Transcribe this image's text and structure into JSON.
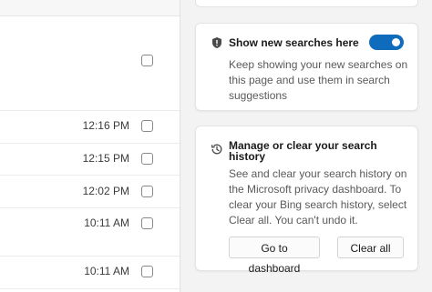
{
  "history_list": {
    "rows": [
      {
        "time": ""
      },
      {
        "time": "12:16 PM"
      },
      {
        "time": "12:15 PM"
      },
      {
        "time": "12:02 PM"
      },
      {
        "time": "10:11 AM"
      },
      {
        "time": "10:11 AM"
      }
    ]
  },
  "settings": {
    "show_new_searches": {
      "title": "Show new searches here",
      "description": "Keep showing your new searches on this page and use them in search suggestions",
      "toggle_on": true,
      "icon": "shield-icon"
    },
    "manage_history": {
      "title": "Manage or clear your search history",
      "description": "See and clear your search history on the Microsoft privacy dashboard. To clear your Bing search history, select Clear all. You can't undo it.",
      "icon": "history-icon",
      "dashboard_button": "Go to dashboard",
      "clear_button": "Clear all"
    }
  },
  "colors": {
    "accent": "#0f6cbd",
    "background": "#f3f3f3",
    "card": "#ffffff"
  }
}
